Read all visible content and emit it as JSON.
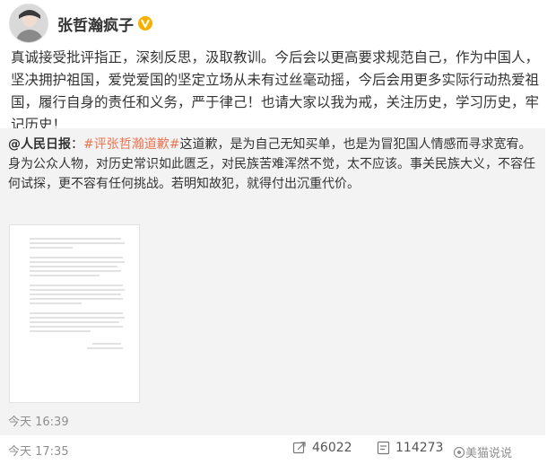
{
  "post": {
    "author": "张哲瀚疯子",
    "text": "真诚接受批评指正，深刻反思，汲取教训。今后会以更高要求规范自己，作为中国人，坚决拥护祖国，爱党爱国的坚定立场从未有过丝毫动摇，今后会用更多实际行动热爱祖国，履行自身的责任和义务，严于律己！也请大家以我为戒，关注历史，学习历史，牢记历史！",
    "time": "今天 17:35"
  },
  "repost": {
    "mention": "@人民日报",
    "hashtag": "#评张哲瀚道歉#",
    "text": "这道歉，是为自己无知买单，也是为冒犯国人情感而寻求宽宥。身为公众人物，对历史常识如此匮乏，对民族苦难浑然不觉，太不应该。事关民族大义，不容任何试探，更不容有任何挑战。若明知故犯，就得付出沉重代价。",
    "time": "今天 16:39"
  },
  "actions": {
    "forward_count": "46022",
    "comment_count": "114273"
  },
  "watermark": {
    "text": "美猫说说"
  },
  "colors": {
    "hashtag": "#eb7350",
    "verified_badge": "#f7b000",
    "repost_bg": "#f3f3f3"
  },
  "icons": [
    "verified-badge-icon",
    "forward-icon",
    "comment-icon"
  ]
}
